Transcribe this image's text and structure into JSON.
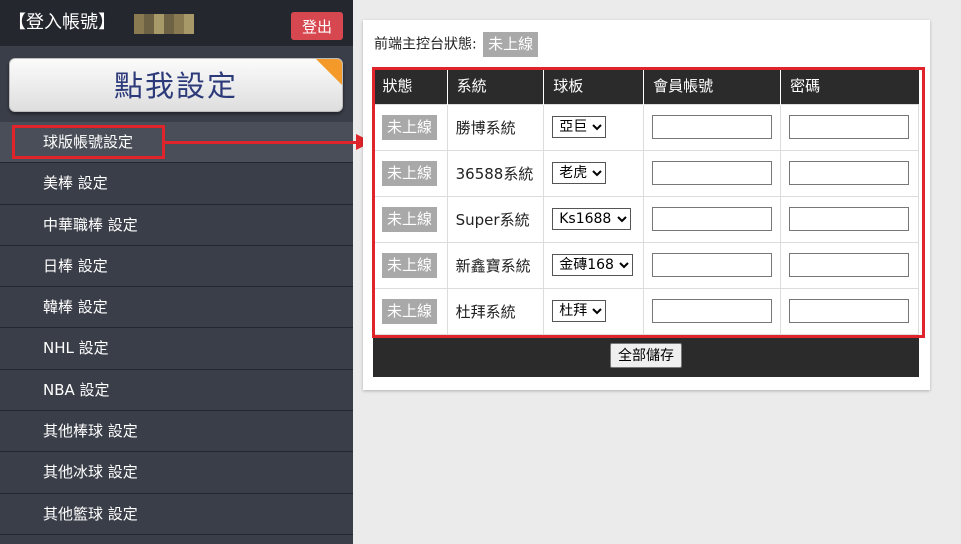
{
  "sidebar": {
    "login_title": "【登入帳號】",
    "logout_label": "登出",
    "big_setting_label": "點我設定",
    "items": [
      {
        "label": "球版帳號設定"
      },
      {
        "label": "美棒 設定"
      },
      {
        "label": "中華職棒 設定"
      },
      {
        "label": "日棒 設定"
      },
      {
        "label": "韓棒 設定"
      },
      {
        "label": "NHL 設定"
      },
      {
        "label": "NBA 設定"
      },
      {
        "label": "其他棒球 設定"
      },
      {
        "label": "其他冰球 設定"
      },
      {
        "label": "其他籃球 設定"
      }
    ],
    "active_index": 0
  },
  "panel": {
    "status_label": "前端主控台狀態:",
    "status_value": "未上線",
    "status_color": "#a9a9a9",
    "headers": [
      "狀態",
      "系統",
      "球板",
      "會員帳號",
      "密碼"
    ],
    "rows": [
      {
        "status": "未上線",
        "system": "勝博系統",
        "board": "亞巨",
        "account": "",
        "password": ""
      },
      {
        "status": "未上線",
        "system": "36588系統",
        "board": "老虎",
        "account": "",
        "password": ""
      },
      {
        "status": "未上線",
        "system": "Super系統",
        "board": "Ks1688",
        "account": "",
        "password": ""
      },
      {
        "status": "未上線",
        "system": "新鑫寶系統",
        "board": "金磚168",
        "account": "",
        "password": ""
      },
      {
        "status": "未上線",
        "system": "杜拜系統",
        "board": "杜拜",
        "account": "",
        "password": ""
      }
    ],
    "save_label": "全部儲存"
  },
  "colors": {
    "sidebar_bg": "#3a3e48",
    "logout_bg": "#d7474f",
    "highlight": "#e0242b",
    "accent_corner": "#f39a2a",
    "table_header_bg": "#2b2b2b"
  }
}
